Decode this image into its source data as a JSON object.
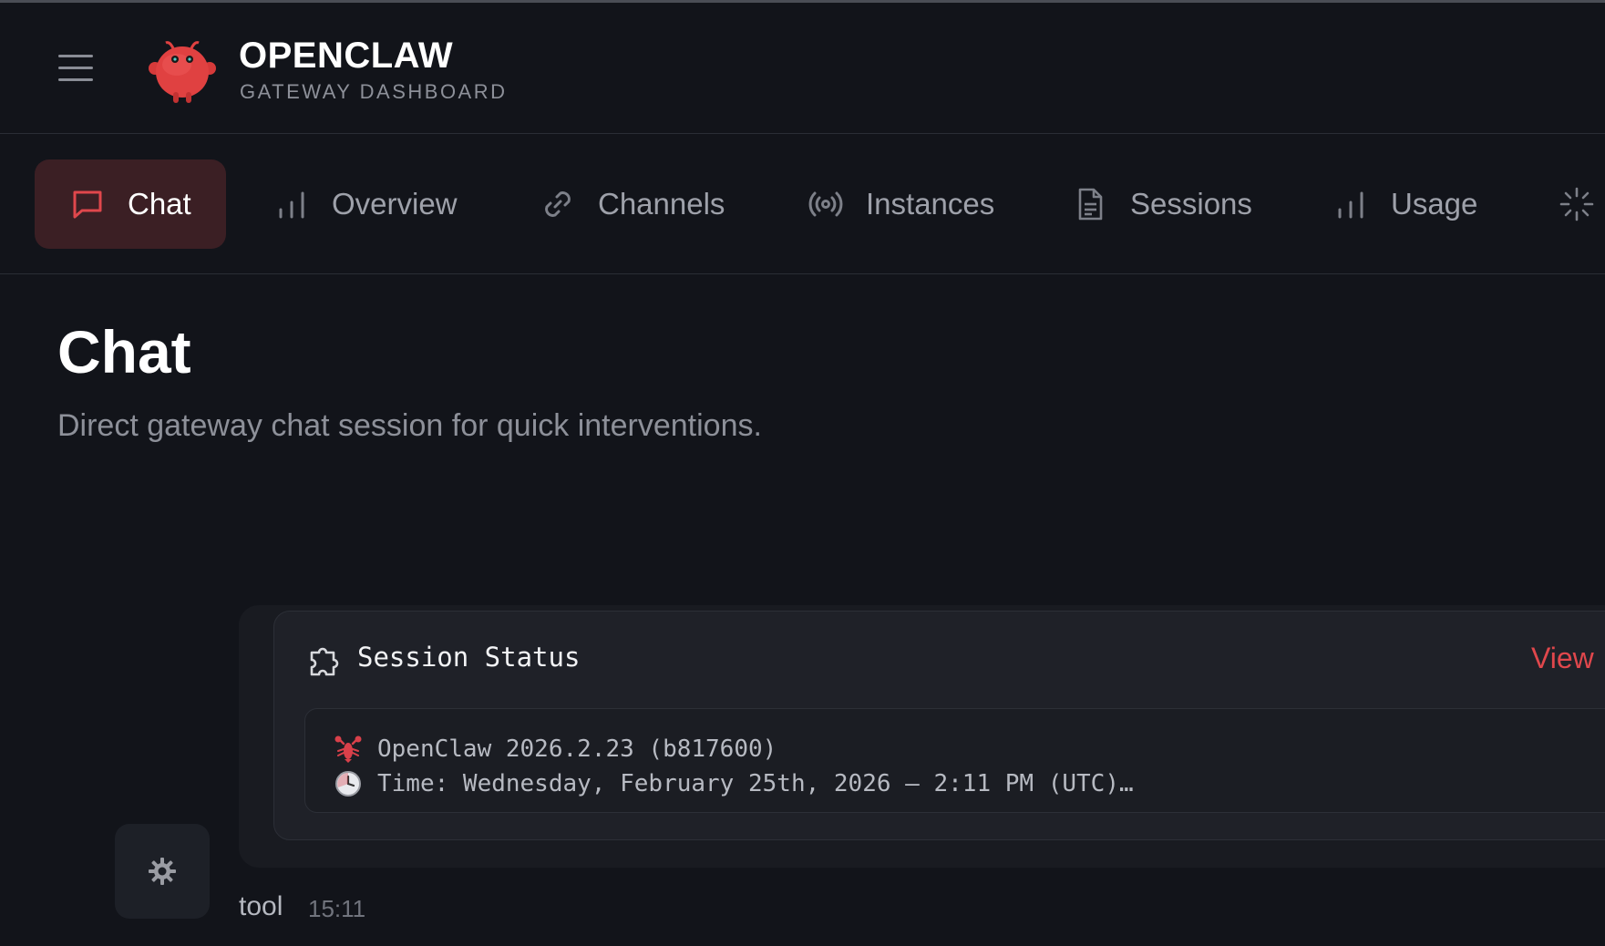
{
  "app": {
    "title": "OPENCLAW",
    "subtitle": "GATEWAY DASHBOARD"
  },
  "tabs": [
    {
      "label": "Chat",
      "icon": "chat-bubble-icon",
      "active": true
    },
    {
      "label": "Overview",
      "icon": "bar-chart-icon",
      "active": false
    },
    {
      "label": "Channels",
      "icon": "link-icon",
      "active": false
    },
    {
      "label": "Instances",
      "icon": "broadcast-icon",
      "active": false
    },
    {
      "label": "Sessions",
      "icon": "document-icon",
      "active": false
    },
    {
      "label": "Usage",
      "icon": "bar-chart-icon",
      "active": false
    },
    {
      "label": "",
      "icon": "loader-icon",
      "active": false
    }
  ],
  "page": {
    "title": "Chat",
    "subtitle": "Direct gateway chat session for quick interventions."
  },
  "message": {
    "card": {
      "title": "Session Status",
      "view_label": "View",
      "lines": [
        {
          "icon": "lobster-icon",
          "text": "OpenClaw 2026.2.23 (b817600)"
        },
        {
          "icon": "clock-icon",
          "text": "Time: Wednesday, February 25th, 2026 — 2:11 PM (UTC)…"
        }
      ]
    },
    "sender": "tool",
    "time": "15:11"
  },
  "colors": {
    "background": "#12141a",
    "accent": "#e0474c",
    "active_tab_bg": "#3b1f24"
  }
}
